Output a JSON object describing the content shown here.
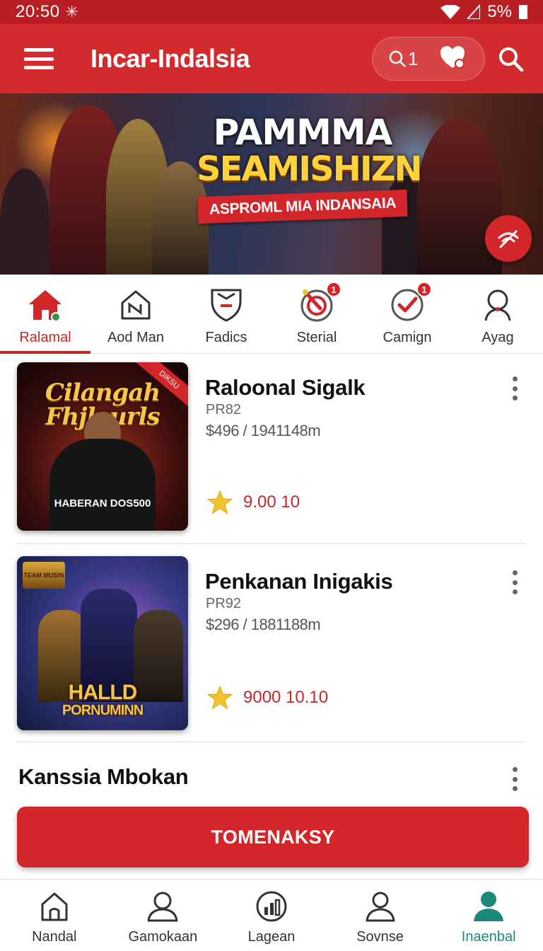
{
  "status_bar": {
    "time": "20:50",
    "battery": "5%"
  },
  "app_bar": {
    "title": "Incar-Indalsia",
    "pill_label": "1"
  },
  "banner": {
    "title_line1": "PAMMMA",
    "title_line2": "SEAMISHIZN",
    "subtitle": "ASPROML MIA INDANSAIA"
  },
  "category_tabs": [
    {
      "label": "Ralamal",
      "icon": "home-icon",
      "active": true
    },
    {
      "label": "Aod Man",
      "icon": "house-outline-icon",
      "active": false
    },
    {
      "label": "Fadics",
      "icon": "shield-icon",
      "active": false
    },
    {
      "label": "Sterial",
      "icon": "target-icon",
      "badge": "1",
      "active": false
    },
    {
      "label": "Camign",
      "icon": "check-circle-icon",
      "badge": "1",
      "active": false
    },
    {
      "label": "Ayag",
      "icon": "user-icon",
      "active": false
    }
  ],
  "games": [
    {
      "title": "Raloonal Sigalk",
      "code": "PR82",
      "price": "$496 / 1941148m",
      "rating": "9.00 10",
      "thumb_title": "Cilangah Fhjleurls",
      "thumb_text": "HABERAN DOS500",
      "thumb_ribbon": "DIKSU"
    },
    {
      "title": "Penkanan Inigakis",
      "code": "PR92",
      "price": "$296 / 1881188m",
      "rating": "9000 10.10",
      "thumb_title": "HALLD",
      "thumb_text": "PORNUMINN",
      "thumb_logo": "TEAM MUSIN"
    }
  ],
  "section": {
    "title": "Kanssia Mbokan"
  },
  "cta": {
    "label": "TOMENAKSY"
  },
  "bottom_nav": [
    {
      "label": "Nandal",
      "icon": "home-outline-icon",
      "active": false
    },
    {
      "label": "Gamokaan",
      "icon": "person-outline-icon",
      "active": false
    },
    {
      "label": "Lagean",
      "icon": "chart-circle-icon",
      "active": false
    },
    {
      "label": "Sovnse",
      "icon": "account-icon",
      "active": false
    },
    {
      "label": "Inaenbal",
      "icon": "profile-filled-icon",
      "active": true
    }
  ],
  "colors": {
    "brand": "#d32a2e",
    "status_bar": "#b81e24",
    "accent_active_nav": "#1a8a7a",
    "rating_star": "#f2c230"
  }
}
